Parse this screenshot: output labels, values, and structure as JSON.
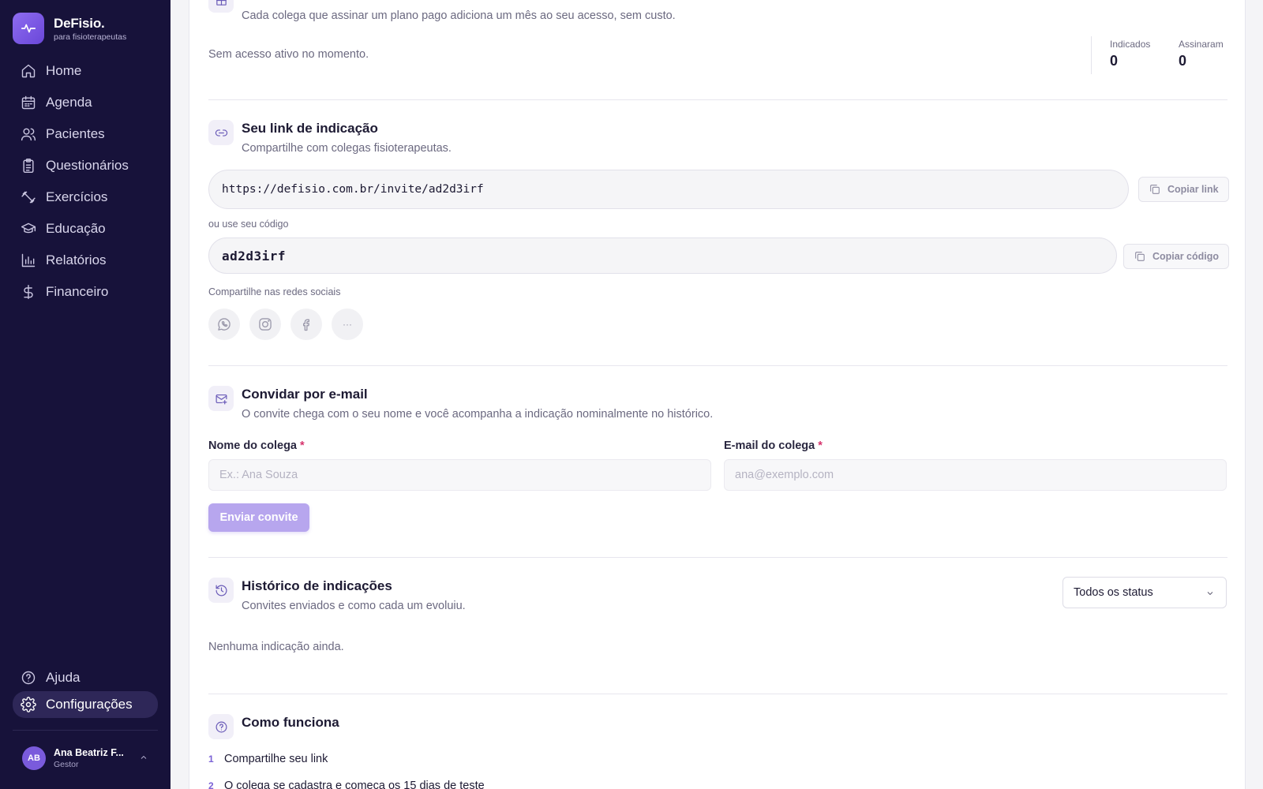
{
  "brand": {
    "name": "DeFisio",
    "dot": ".",
    "subtitle": "para fisioterapeutas"
  },
  "nav": [
    {
      "label": "Home",
      "icon": "home-icon"
    },
    {
      "label": "Agenda",
      "icon": "calendar-icon"
    },
    {
      "label": "Pacientes",
      "icon": "users-icon"
    },
    {
      "label": "Questionários",
      "icon": "clipboard-icon"
    },
    {
      "label": "Exercícios",
      "icon": "dumbbell-icon"
    },
    {
      "label": "Educação",
      "icon": "graduation-cap-icon"
    },
    {
      "label": "Relatórios",
      "icon": "bar-chart-icon"
    },
    {
      "label": "Financeiro",
      "icon": "dollar-icon"
    }
  ],
  "nav_bottom": [
    {
      "label": "Ajuda",
      "icon": "help-circle-icon"
    },
    {
      "label": "Configurações",
      "icon": "gear-icon",
      "active": true
    }
  ],
  "user": {
    "initials": "AB",
    "name": "Ana Beatriz F...",
    "role": "Gestor"
  },
  "top": {
    "subtitle": "Cada colega que assinar um plano pago adiciona um mês ao seu acesso, sem custo.",
    "status": "Sem acesso ativo no momento.",
    "stats": [
      {
        "label": "Indicados",
        "value": "0"
      },
      {
        "label": "Assinaram",
        "value": "0"
      }
    ]
  },
  "link_section": {
    "title": "Seu link de indicação",
    "subtitle": "Compartilhe com colegas fisioterapeutas.",
    "url": "https://defisio.com.br/invite/ad2d3irf",
    "copy_link_label": "Copiar link",
    "code_label": "ou use seu código",
    "code": "ad2d3irf",
    "copy_code_label": "Copiar código",
    "social_label": "Compartilhe nas redes sociais",
    "more_label": "···"
  },
  "email_section": {
    "title": "Convidar por e-mail",
    "subtitle": "O convite chega com o seu nome e você acompanha a indicação nominalmente no histórico.",
    "name_label": "Nome do colega",
    "name_placeholder": "Ex.: Ana Souza",
    "email_label": "E-mail do colega",
    "email_placeholder": "ana@exemplo.com",
    "required_mark": "*",
    "submit_label": "Enviar convite"
  },
  "history_section": {
    "title": "Histórico de indicações",
    "subtitle": "Convites enviados e como cada um evoluiu.",
    "filter_value": "Todos os status",
    "empty": "Nenhuma indicação ainda."
  },
  "how_section": {
    "title": "Como funciona",
    "steps": [
      {
        "num": "1",
        "text": "Compartilhe seu link"
      },
      {
        "num": "2",
        "text": "O colega se cadastra e começa os 15 dias de teste"
      }
    ]
  },
  "colors": {
    "sidebar": "#17123a",
    "accent": "#7b62d6",
    "primary_disabled": "#b7a6ee"
  }
}
